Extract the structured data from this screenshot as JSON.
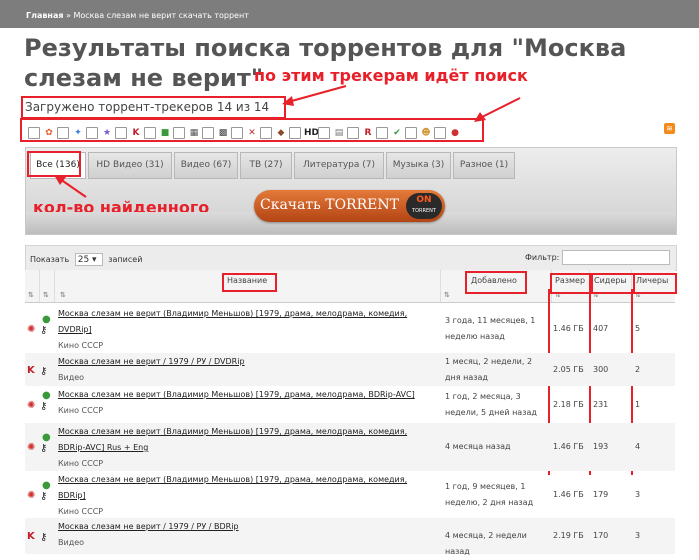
{
  "breadcrumb": {
    "home": "Главная",
    "separator": "»",
    "current": "Москва слезам не верит скачать торрент"
  },
  "page_title": "Результаты поиска торрентов для \"Москва слезам не верит\"",
  "annotations": {
    "trackers_note": "по этим трекерам идёт поиск",
    "count_note": "кол-во найденного"
  },
  "loaded_text": "Загружено торрент-трекеров 14 из 14",
  "trackers": [
    {
      "icon": "flower-icon",
      "glyph": "✿",
      "color": "#e0612a"
    },
    {
      "icon": "bird-icon",
      "glyph": "✦",
      "color": "#3b7bd8"
    },
    {
      "icon": "star-icon",
      "glyph": "★",
      "color": "#7a5bc8"
    },
    {
      "icon": "k-icon",
      "glyph": "K",
      "color": "#c0202a"
    },
    {
      "icon": "cube-icon",
      "glyph": "■",
      "color": "#3a9a3a"
    },
    {
      "icon": "film-icon",
      "glyph": "▦",
      "color": "#555555"
    },
    {
      "icon": "grid-icon",
      "glyph": "▩",
      "color": "#444444"
    },
    {
      "icon": "cross-icon",
      "glyph": "✕",
      "color": "#c03030"
    },
    {
      "icon": "shield-icon",
      "glyph": "◆",
      "color": "#8a4a2a"
    },
    {
      "icon": "hd-icon",
      "glyph": "HD",
      "color": "#222222"
    },
    {
      "icon": "page-icon",
      "glyph": "▤",
      "color": "#777777"
    },
    {
      "icon": "r-icon",
      "glyph": "R",
      "color": "#c0202a"
    },
    {
      "icon": "leaf-icon",
      "glyph": "✔",
      "color": "#3a9a3a"
    },
    {
      "icon": "person-icon",
      "glyph": "☻",
      "color": "#d09a3a"
    },
    {
      "icon": "ball-icon",
      "glyph": "●",
      "color": "#d03030"
    }
  ],
  "tabs": [
    {
      "label": "Все (136)",
      "active": true
    },
    {
      "label": "HD Видео (31)"
    },
    {
      "label": "Видео (67)"
    },
    {
      "label": "ТВ (27)"
    },
    {
      "label": "Литература (7)"
    },
    {
      "label": "Музыка (3)"
    },
    {
      "label": "Разное (1)"
    }
  ],
  "download_button": {
    "text": "Скачать TORRENT",
    "badge_on": "ON",
    "badge_sub": "TORRENT"
  },
  "controls": {
    "show_label": "Показать",
    "show_value": "25",
    "records_label": "записей",
    "filter_label": "Фильтр:",
    "filter_value": ""
  },
  "table": {
    "columns": {
      "name": "Название",
      "added": "Добавлено",
      "size": "Размер",
      "seeders": "Сидеры",
      "leechers": "Личеры"
    },
    "rows": [
      {
        "title_lines": [
          "Москва слезам не верит (Владимир Меньшов) [1979, драма, мелодрама, комедия,",
          "DVDRip]"
        ],
        "category": "Кино СССР",
        "added_lines": [
          "3 года, 11 месяцев, 1",
          "неделю назад"
        ],
        "size": "1.46 ГБ",
        "seeders": "407",
        "leechers": "5",
        "tracker": "ball"
      },
      {
        "title_lines": [
          "Москва слезам не верит / 1979 / РУ / DVDRip"
        ],
        "category": "Видео",
        "added_lines": [
          "1 месяц, 2 недели, 2",
          "дня назад"
        ],
        "size": "2.05 ГБ",
        "seeders": "300",
        "leechers": "2",
        "tracker": "k"
      },
      {
        "title_lines": [
          "Москва слезам не верит (Владимир Меньшов) [1979, драма, мелодрама, BDRip-AVC]"
        ],
        "category": "Кино СССР",
        "added_lines": [
          "1 год, 2 месяца, 3",
          "недели, 5 дней назад"
        ],
        "size": "2.18 ГБ",
        "seeders": "231",
        "leechers": "1",
        "tracker": "ball"
      },
      {
        "title_lines": [
          "Москва слезам не верит (Владимир Меньшов) [1979, драма, мелодрама, комедия,",
          "BDRip-AVC] Rus + Eng"
        ],
        "category": "Кино СССР",
        "added_lines": [
          "4 месяца назад"
        ],
        "size": "1.46 ГБ",
        "seeders": "193",
        "leechers": "4",
        "tracker": "ball"
      },
      {
        "title_lines": [
          "Москва слезам не верит (Владимир Меньшов) [1979, драма, мелодрама, комедия,",
          "BDRip]"
        ],
        "category": "Кино СССР",
        "added_lines": [
          "1 год, 9 месяцев, 1",
          "неделю, 2 дня назад"
        ],
        "size": "1.46 ГБ",
        "seeders": "179",
        "leechers": "3",
        "tracker": "ball"
      },
      {
        "title_lines": [
          "Москва слезам не верит / 1979 / РУ / BDRip"
        ],
        "category": "Видео",
        "added_lines": [
          "4 месяца, 2 недели назад"
        ],
        "size": "2.19 ГБ",
        "seeders": "170",
        "leechers": "3",
        "tracker": "k"
      }
    ]
  },
  "colors": {
    "annotation_red": "#e8202a",
    "topbar": "#7d7d7d",
    "button_orange": "#d0602a"
  }
}
